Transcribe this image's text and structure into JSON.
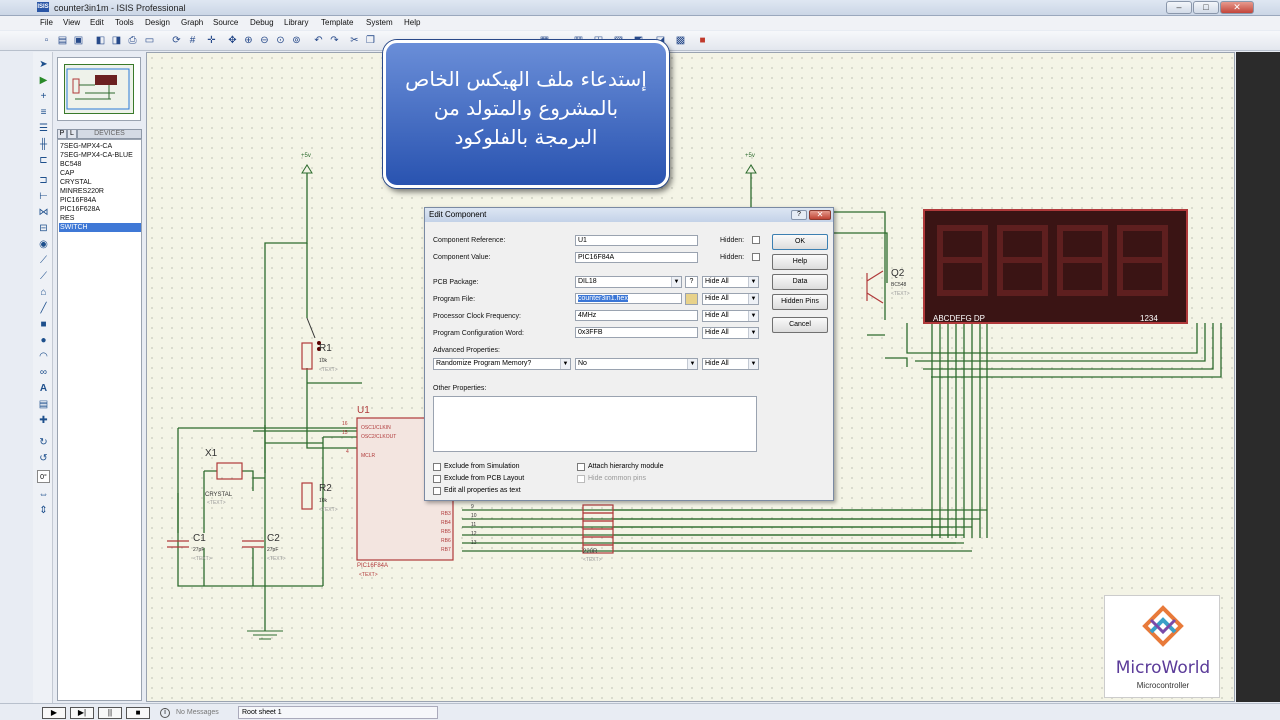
{
  "window": {
    "title": "counter3in1m - ISIS Professional",
    "app_icon": "ISIS",
    "min": "–",
    "max": "□",
    "close": "✕"
  },
  "menu": [
    "File",
    "View",
    "Edit",
    "Tools",
    "Design",
    "Graph",
    "Source",
    "Debug",
    "Library",
    "Template",
    "System",
    "Help"
  ],
  "device_panel": {
    "tab_p": "P",
    "tab_l": "L",
    "header": "DEVICES",
    "items": [
      "7SEG-MPX4-CA",
      "7SEG-MPX4-CA-BLUE",
      "BC548",
      "CAP",
      "CRYSTAL",
      "MINRES220R",
      "PIC16F84A",
      "PIC16F628A",
      "RES",
      "SWITCH"
    ],
    "selected": "SWITCH"
  },
  "schematic": {
    "power_label": "+5v",
    "r1": {
      "ref": "R1",
      "value": "10k",
      "text": "<TEXT>"
    },
    "r2": {
      "ref": "R2",
      "value": "10k",
      "text": "<TEXT>"
    },
    "x1": {
      "ref": "X1",
      "value": "CRYSTAL",
      "text": "<TEXT>"
    },
    "c1": {
      "ref": "C1",
      "value": "27pF",
      "text": "<TEXT>"
    },
    "c2": {
      "ref": "C2",
      "value": "27pF",
      "text": "<TEXT>"
    },
    "u1": {
      "ref": "U1",
      "part": "PIC16F84A",
      "text": "<TEXT>",
      "pins_left": [
        "OSC1/CLKIN",
        "OSC2/CLKOUT",
        "MCLR"
      ],
      "pin_nums_left": [
        "16",
        "15",
        "4"
      ],
      "pins_right": [
        "RB3",
        "RB4",
        "RB5",
        "RB6",
        "RB7"
      ],
      "pin_nums_right": [
        "9",
        "10",
        "11",
        "12",
        "13"
      ]
    },
    "q2": {
      "ref": "Q2",
      "part": "BC548",
      "text": "<TEXT>"
    },
    "rpack": {
      "value": "220R",
      "text": "<TEXT>"
    },
    "display": {
      "seg_label": "ABCDEFG  DP",
      "digit_label": "1234"
    }
  },
  "callout": {
    "line1": "إستدعاء ملف الهيكس الخاص",
    "line2": "بالمشروع والمتولد من",
    "line3": "البرمجة بالفلوكود"
  },
  "dialog": {
    "title": "Edit Component",
    "help_glyph": "?",
    "close_glyph": "✕",
    "fields": {
      "ref_label": "Component Reference:",
      "ref_value": "U1",
      "hidden1": "Hidden:",
      "val_label": "Component Value:",
      "val_value": "PIC16F84A",
      "hidden2": "Hidden:",
      "pcb_label": "PCB Package:",
      "pcb_value": "DIL18",
      "pcb_hide": "Hide All",
      "pcb_q": "?",
      "prog_label": "Program File:",
      "prog_value": "counter3in1.hex",
      "prog_hide": "Hide All",
      "clock_label": "Processor Clock Frequency:",
      "clock_value": "4MHz",
      "clock_hide": "Hide All",
      "config_label": "Program Configuration Word:",
      "config_value": "0x3FFB",
      "config_hide": "Hide All",
      "adv_label": "Advanced Properties:",
      "adv_prop": "Randomize Program Memory?",
      "adv_value": "No",
      "adv_hide": "Hide All",
      "other_label": "Other Properties:"
    },
    "checks": {
      "sim": "Exclude from Simulation",
      "pcb": "Exclude from PCB Layout",
      "edit": "Edit all properties as text",
      "attach": "Attach hierarchy module",
      "hide": "Hide common pins"
    },
    "buttons": {
      "ok": "OK",
      "help": "Help",
      "data": "Data",
      "hidden_pins": "Hidden Pins",
      "cancel": "Cancel"
    }
  },
  "status": {
    "messages": "No Messages",
    "sheet": "Root sheet 1"
  },
  "logo": {
    "name": "MicroWorld",
    "sub": "Microcontroller"
  },
  "colors": {
    "wire": "#2d6b2d",
    "part": "#b0393a",
    "canvas": "#f4f4e6",
    "callout": "#2953b0",
    "display_bg": "#3a1414"
  }
}
